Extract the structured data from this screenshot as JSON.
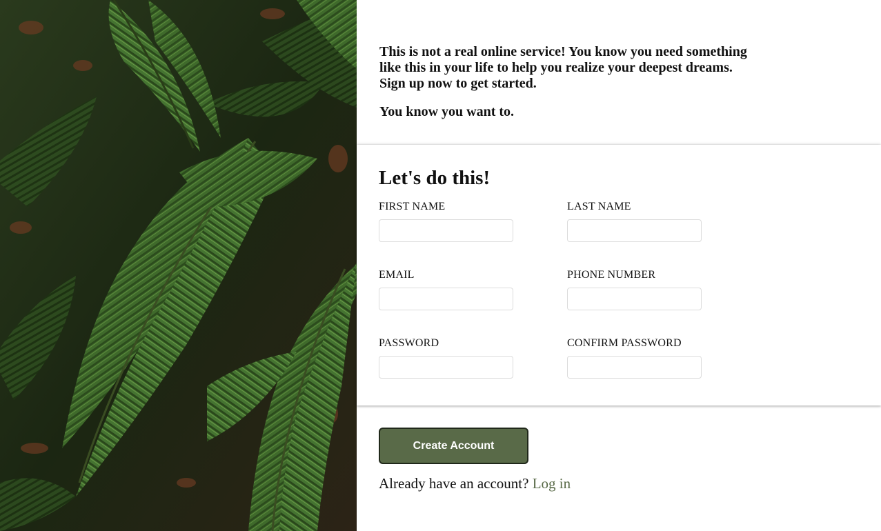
{
  "intro": {
    "lines": [
      "This is not a real online service! You know you need something",
      "like this in your life to help you realize your deepest dreams.",
      "Sign up now to get started."
    ],
    "tagline": "You know you want to."
  },
  "form": {
    "title": "Let's do this!",
    "fields": [
      {
        "label": "FIRST NAME",
        "value": ""
      },
      {
        "label": "LAST NAME",
        "value": ""
      },
      {
        "label": "EMAIL",
        "value": ""
      },
      {
        "label": "PHONE NUMBER",
        "value": ""
      },
      {
        "label": "PASSWORD",
        "value": ""
      },
      {
        "label": "CONFIRM PASSWORD",
        "value": ""
      }
    ]
  },
  "actions": {
    "create_label": "Create Account",
    "login_prompt": "Already have an account?",
    "login_link": "Log in"
  },
  "colors": {
    "accent": "#596a48",
    "accent_border": "#20281a",
    "panel_bg": "#ffffff"
  },
  "hero": {
    "icon": "fern-leaves-photo"
  }
}
